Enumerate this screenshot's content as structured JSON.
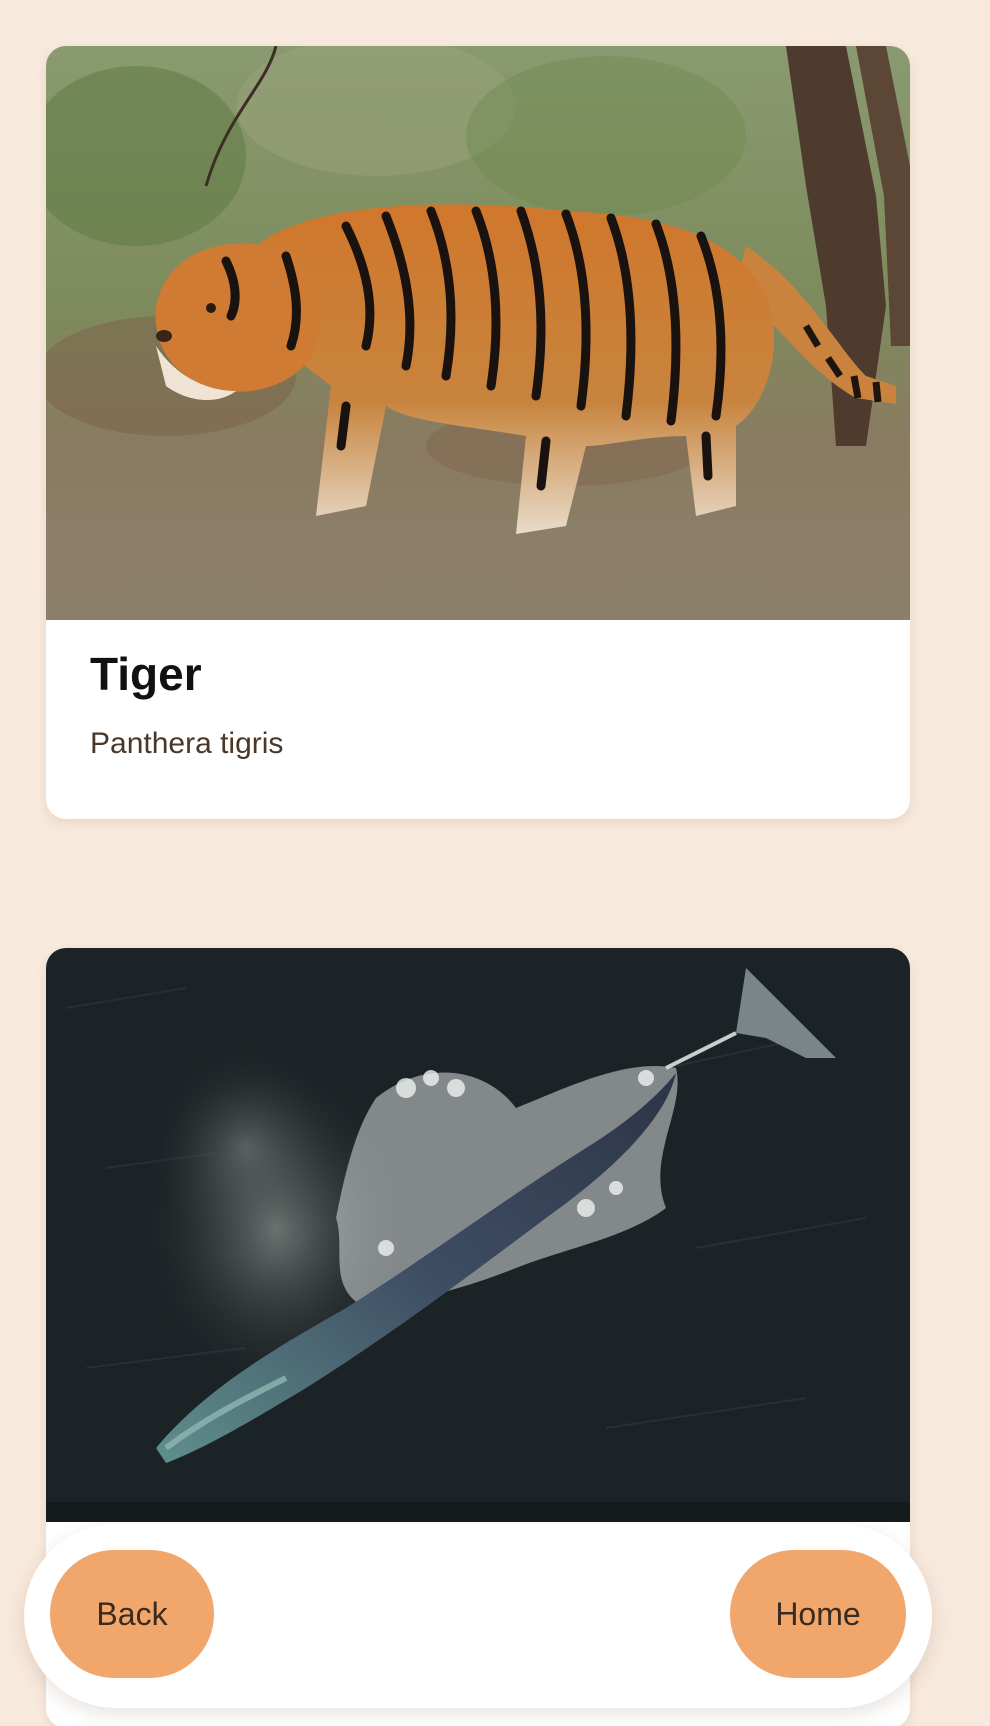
{
  "cards": [
    {
      "title": "Tiger",
      "subtitle": "Panthera tigris",
      "image_subject": "tiger-photo"
    },
    {
      "image_subject": "whale-photo"
    }
  ],
  "nav": {
    "back_label": "Back",
    "home_label": "Home"
  },
  "colors": {
    "page_background": "#f8e9dd",
    "card_background": "#ffffff",
    "button_background": "#f1a66c",
    "button_text": "#3b2a1e",
    "subtitle_text": "#4a3728"
  }
}
